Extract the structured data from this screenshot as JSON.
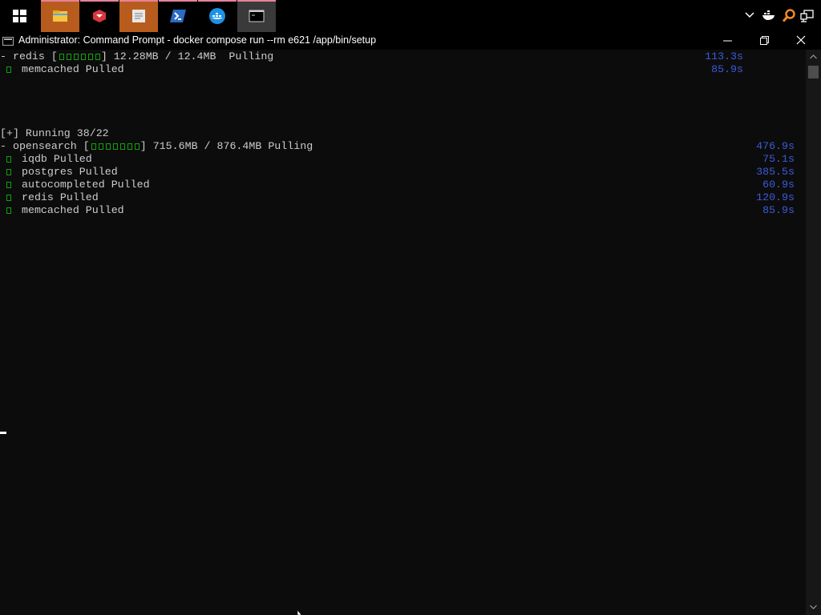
{
  "taskbar": {
    "apps": [
      {
        "name": "file-explorer",
        "active": false,
        "highlighted": true
      },
      {
        "name": "gitkraken",
        "active": false,
        "highlighted": false
      },
      {
        "name": "notepad",
        "active": false,
        "highlighted": true
      },
      {
        "name": "powershell",
        "active": false,
        "highlighted": false
      },
      {
        "name": "docker-desktop",
        "active": false,
        "highlighted": false
      },
      {
        "name": "command-prompt",
        "active": true,
        "highlighted": false
      }
    ]
  },
  "window": {
    "title": "Administrator: Command Prompt - docker  compose run --rm e621 /app/bin/setup"
  },
  "console": {
    "block1": [
      {
        "prefix": "- ",
        "status": "pulling",
        "name": "redis",
        "bar": "[",
        "bar_end": "] 12.28MB / 12.4MB  Pulling",
        "time": "113.3s"
      },
      {
        "prefix": "",
        "status": "pulled",
        "text": "memcached Pulled",
        "time": "85.9s"
      }
    ],
    "running_header": "[+] Running 38/22",
    "block2": [
      {
        "prefix": "- ",
        "status": "pulling",
        "name": "opensearch",
        "bar": "[",
        "bar_end": "] 715.6MB / 876.4MB Pulling",
        "time": "476.9s"
      },
      {
        "prefix": "",
        "status": "pulled",
        "text": "iqdb Pulled",
        "time": "75.1s"
      },
      {
        "prefix": "",
        "status": "pulled",
        "text": "postgres Pulled",
        "time": "385.5s"
      },
      {
        "prefix": "",
        "status": "pulled",
        "text": "autocompleted Pulled",
        "time": "60.9s"
      },
      {
        "prefix": "",
        "status": "pulled",
        "text": "redis Pulled",
        "time": "120.9s"
      },
      {
        "prefix": "",
        "status": "pulled",
        "text": "memcached Pulled",
        "time": "85.9s"
      }
    ]
  },
  "colors": {
    "background": "#0c0c0c",
    "text": "#cccccc",
    "success": "#13a10e",
    "timer": "#3b5bdb"
  }
}
